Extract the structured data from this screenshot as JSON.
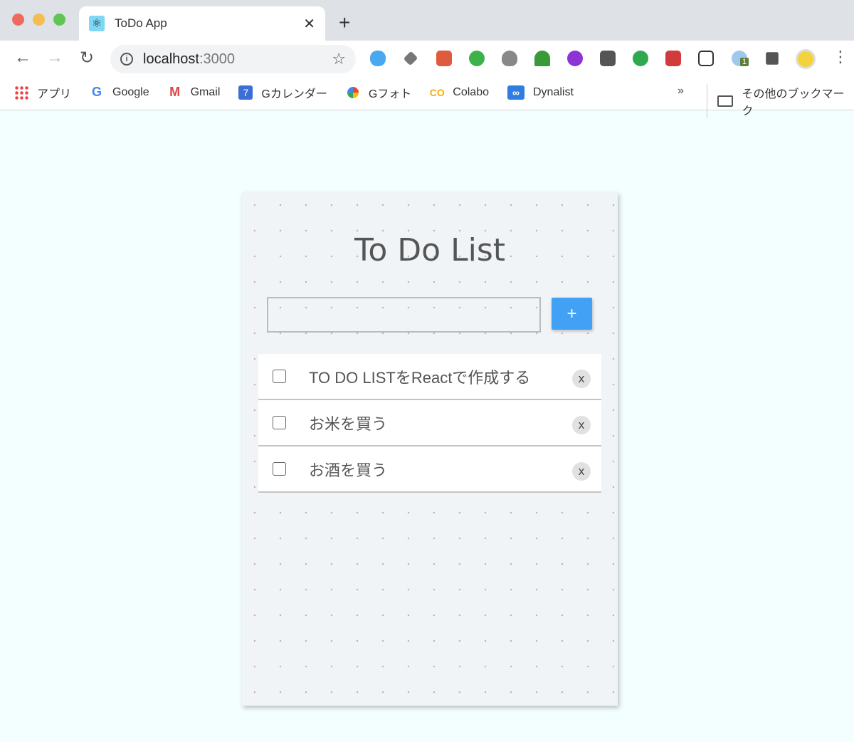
{
  "browser": {
    "tab": {
      "title": "ToDo App",
      "favicon": "react-icon"
    },
    "url": {
      "host": "localhost",
      "port": ":3000"
    },
    "extensions": [
      "icloud-icon",
      "dropbox-icon",
      "bookmark-star-icon",
      "share-icon",
      "bug-icon",
      "html-tree-icon",
      "face-icon",
      "lightbulb-icon",
      "evernote-icon",
      "paw-icon",
      "cube-icon",
      "badge-icon",
      "puzzle-icon",
      "avatar"
    ],
    "extension_badge": "1",
    "bookmarks": [
      {
        "label": "アプリ",
        "icon": "apps-grid-icon"
      },
      {
        "label": "Google",
        "icon": "google-icon"
      },
      {
        "label": "Gmail",
        "icon": "gmail-icon"
      },
      {
        "label": "Gカレンダー",
        "icon": "calendar-icon",
        "icon_text": "7"
      },
      {
        "label": "Gフォト",
        "icon": "photos-icon"
      },
      {
        "label": "Colabo",
        "icon": "colab-icon",
        "icon_text": "CO"
      },
      {
        "label": "Dynalist",
        "icon": "dynalist-icon",
        "icon_text": "∞"
      }
    ],
    "more_label": "»",
    "other_bookmarks": "その他のブックマーク"
  },
  "app": {
    "title": "To Do List",
    "input": {
      "value": "",
      "placeholder": ""
    },
    "add_label": "+",
    "accent": "#42a1f5",
    "todos": [
      {
        "text": "TO DO LISTをReactで作成する",
        "done": false,
        "delete_label": "x"
      },
      {
        "text": "お米を買う",
        "done": false,
        "delete_label": "x"
      },
      {
        "text": "お酒を買う",
        "done": false,
        "delete_label": "x"
      }
    ]
  }
}
